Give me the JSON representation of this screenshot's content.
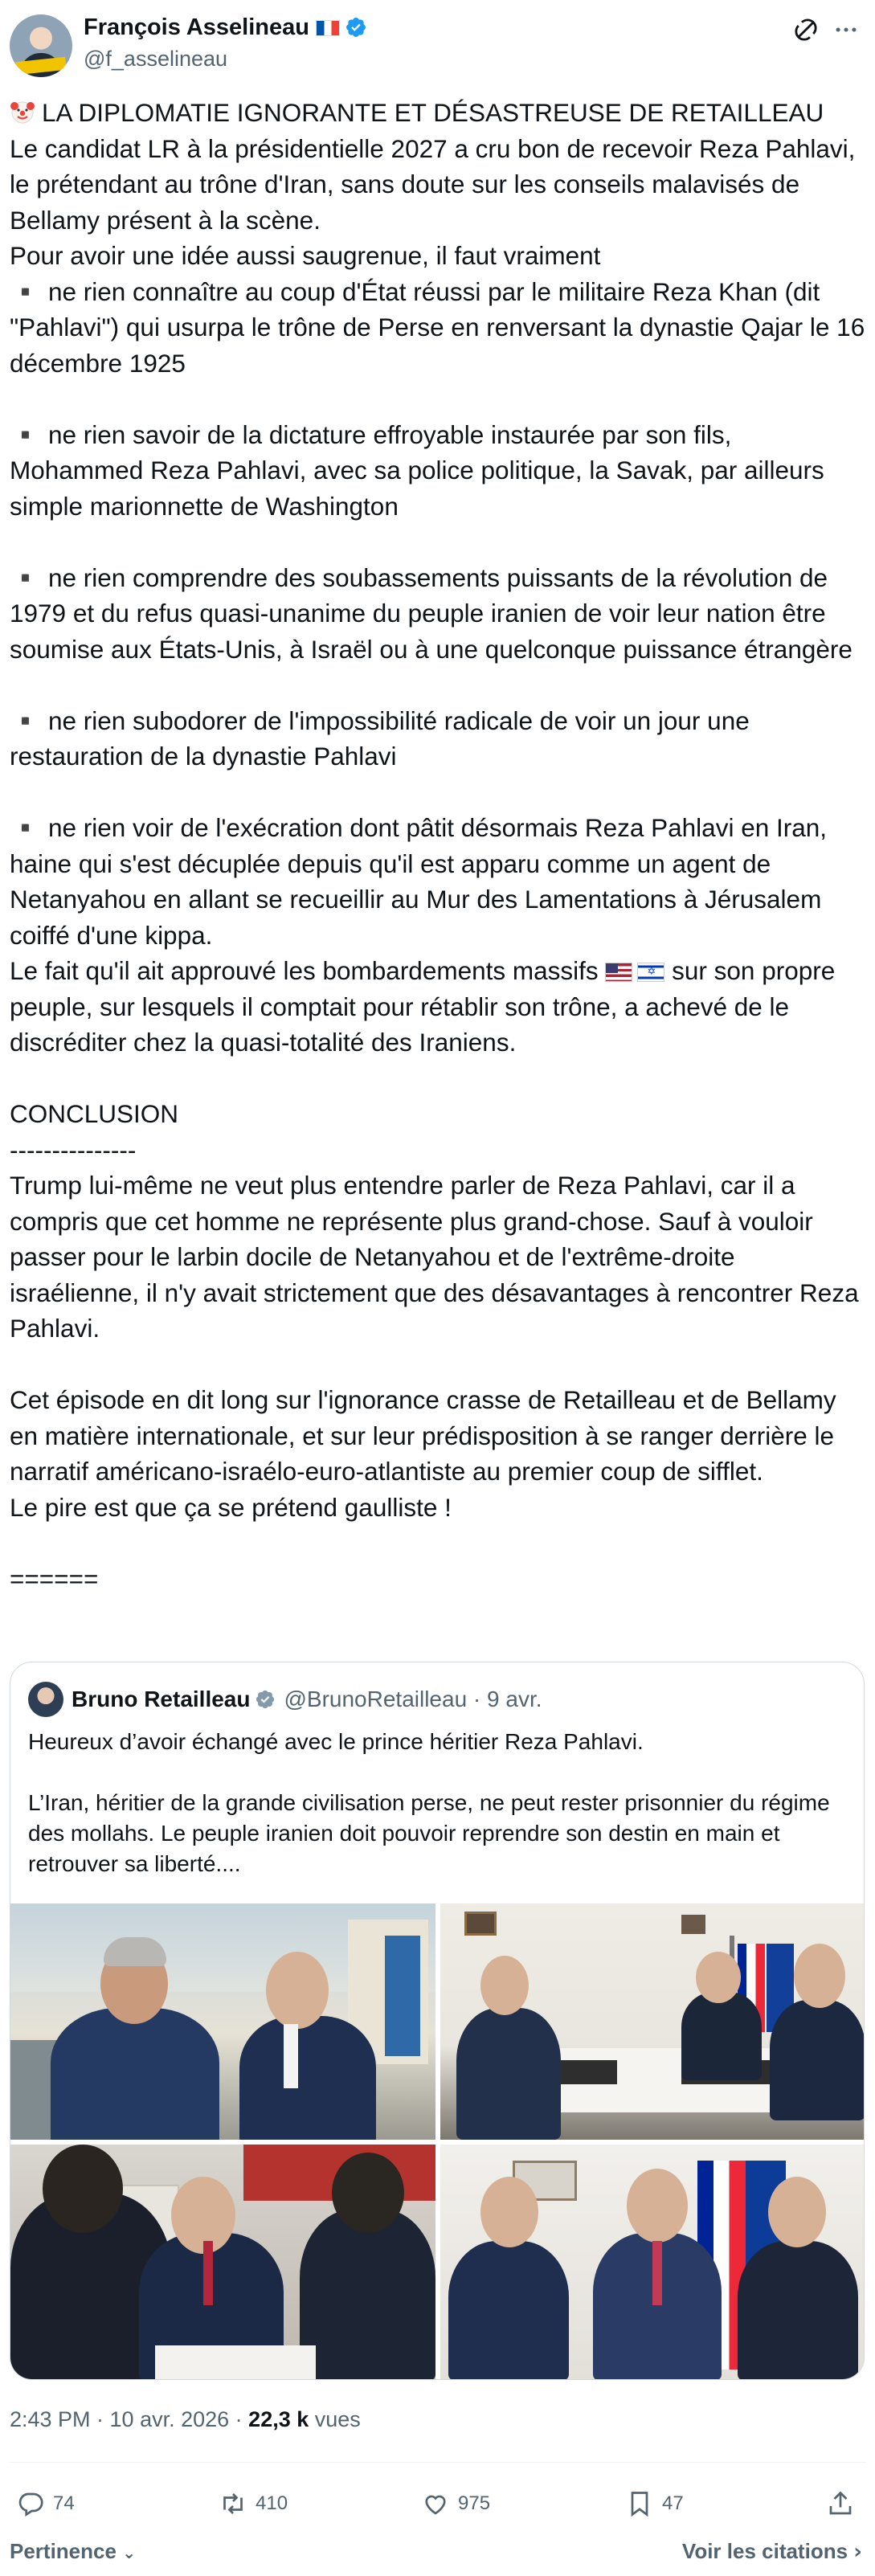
{
  "author": {
    "name": "François Asselineau",
    "handle": "@f_asselineau"
  },
  "tweet": {
    "headline": "LA DIPLOMATIE IGNORANTE ET DÉSASTREUSE DE RETAILLEAU",
    "para1": "Le candidat LR à la présidentielle 2027 a cru bon de recevoir Reza Pahlavi, le prétendant au trône d'Iran, sans doute sur les conseils malavisés de Bellamy présent à la scène.\nPour avoir une idée aussi saugrenue, il faut vraiment",
    "bullet1": "▪️ ne rien connaître au coup d'État réussi par le militaire Reza Khan (dit \"Pahlavi\") qui usurpa le trône de Perse en renversant la dynastie Qajar le 16 décembre 1925",
    "bullet2": "▪️ ne rien savoir de la dictature effroyable instaurée par son fils, Mohammed Reza Pahlavi, avec sa police politique, la Savak, par ailleurs simple marionnette de Washington",
    "bullet3": "▪️ ne rien comprendre des soubassements puissants de la révolution de 1979 et du refus quasi-unanime du peuple iranien de voir leur nation être soumise aux États-Unis, à Israël ou à une quelconque puissance étrangère",
    "bullet4": "▪️ ne rien subodorer de l'impossibilité radicale de voir un jour une restauration de la dynastie Pahlavi",
    "bullet5": "▪️ ne rien voir de l'exécration dont pâtit désormais Reza Pahlavi en Iran, haine qui s'est décuplée depuis qu'il est apparu comme un agent de Netanyahou en allant se recueillir au Mur des Lamentations à Jérusalem coiffé d'une kippa.",
    "para2_start": "Le fait qu'il ait approuvé les bombardements massifs ",
    "para2_end": " sur son propre peuple, sur lesquels il comptait pour rétablir son trône, a achevé de le discréditer chez la quasi-totalité des Iraniens.",
    "conclusion_title": "CONCLUSION\n---------------",
    "conclusion1": "Trump lui-même ne veut plus entendre parler de Reza Pahlavi, car il a compris que cet homme ne représente plus grand-chose. Sauf à vouloir passer pour le larbin docile de Netanyahou et de l'extrême-droite israélienne, il n'y avait strictement que des désavantages à rencontrer Reza Pahlavi.",
    "conclusion2": "Cet épisode en dit long sur l'ignorance crasse de Retailleau et de Bellamy en matière internationale, et sur leur prédisposition à se ranger derrière le narratif américano-israélo-euro-atlantiste au premier coup de sifflet.\nLe pire est que ça se prétend gaulliste !",
    "closing": "======"
  },
  "quote": {
    "name": "Bruno Retailleau",
    "handle": "@BrunoRetailleau · 9 avr.",
    "text": "Heureux d’avoir échangé avec le prince héritier Reza Pahlavi.\n\nL’Iran, héritier de la grande civilisation perse, ne peut rester prisonnier du régime des mollahs. Le peuple iranien doit pouvoir reprendre son destin en main et retrouver sa liberté...."
  },
  "meta": {
    "time": "2:43 PM · 10 avr. 2026 · ",
    "views_count": "22,3 k",
    "views_label": " vues"
  },
  "actions": {
    "replies": "74",
    "reposts": "410",
    "likes": "975",
    "bookmarks": "47"
  },
  "footer": {
    "sort_label": "Pertinence",
    "view_quotes": "Voir les citations"
  },
  "colors": {
    "verified_blue": "#1d9bf0",
    "verified_gray": "#829aab",
    "text": "#0f1419",
    "secondary": "#536471"
  }
}
